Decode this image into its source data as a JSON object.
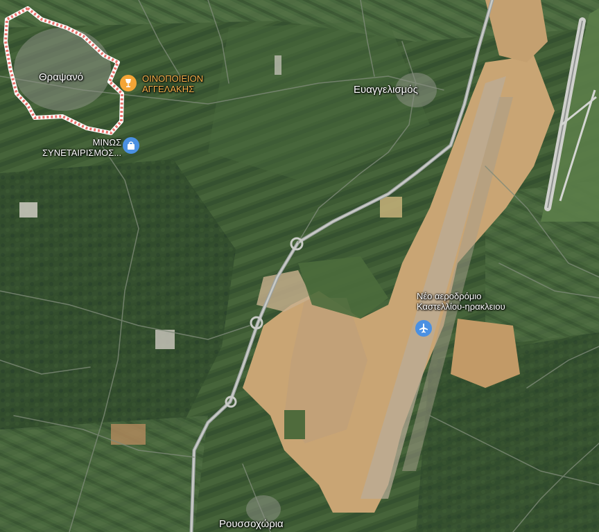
{
  "map": {
    "type": "satellite",
    "places": {
      "thrapsano": "Θραψανό",
      "evangelismos": "Ευαγγελισμός",
      "roussochoria": "Ρουσσοχώρια"
    },
    "pois": {
      "winery": {
        "line1": "ΟΙΝΟΠΟΙΕΙΟΝ",
        "line2": "ΑΓΓΕΛΑΚΗΣ",
        "icon": "wine-glass-icon",
        "color": "#F4A536"
      },
      "cooperative": {
        "line1": "ΜΙΝΩΣ",
        "line2": "ΣΥΝΕΤΑΙΡΙΣΜΟΣ...",
        "icon": "shopping-bag-icon",
        "color": "#4A90E2"
      },
      "airport": {
        "line1": "Νέο αεροδρόμιο",
        "line2": "Καστελλίου-ηρακλειου",
        "icon": "airplane-icon",
        "color": "#4A90E2"
      }
    },
    "boundary_color": "#E8736C"
  }
}
